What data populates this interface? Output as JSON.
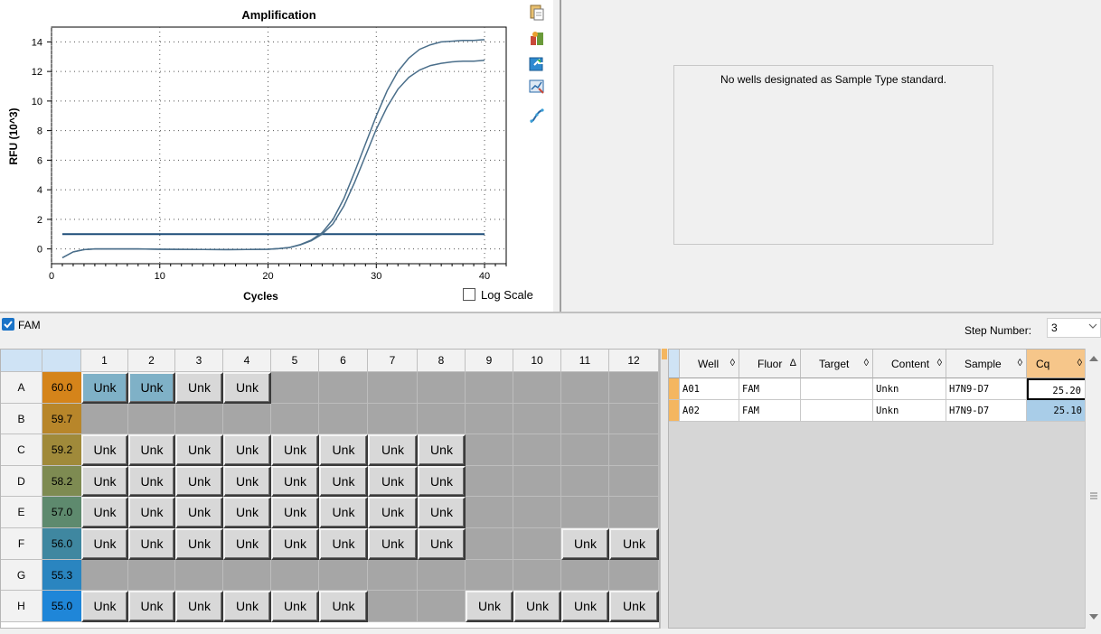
{
  "chart_data": {
    "type": "line",
    "title": "Amplification",
    "xlabel": "Cycles",
    "ylabel": "RFU (10^3)",
    "xlim": [
      0,
      42
    ],
    "ylim": [
      -1,
      15
    ],
    "xticks": [
      0,
      10,
      20,
      30,
      40
    ],
    "yticks": [
      0,
      2,
      4,
      6,
      8,
      10,
      12,
      14
    ],
    "grid": "dotted",
    "threshold": 1.0,
    "series": [
      {
        "well": "A01",
        "color": "#4a6e8a",
        "x": [
          1,
          2,
          3,
          4,
          6,
          8,
          10,
          12,
          14,
          16,
          18,
          20,
          21,
          22,
          23,
          24,
          25,
          26,
          27,
          28,
          29,
          30,
          31,
          32,
          33,
          34,
          35,
          36,
          37,
          38,
          39,
          40
        ],
        "y": [
          -0.6,
          -0.2,
          -0.05,
          0,
          0,
          0,
          -0.02,
          -0.03,
          -0.04,
          -0.05,
          -0.04,
          -0.02,
          0.02,
          0.1,
          0.3,
          0.6,
          1.1,
          2.0,
          3.4,
          5.2,
          7.1,
          9.0,
          10.7,
          12.0,
          12.9,
          13.5,
          13.8,
          14.0,
          14.05,
          14.1,
          14.1,
          14.15
        ]
      },
      {
        "well": "A02",
        "color": "#4a6e8a",
        "x": [
          1,
          2,
          3,
          4,
          6,
          8,
          10,
          12,
          14,
          16,
          18,
          20,
          21,
          22,
          23,
          24,
          25,
          26,
          27,
          28,
          29,
          30,
          31,
          32,
          33,
          34,
          35,
          36,
          37,
          38,
          39,
          40
        ],
        "y": [
          -0.6,
          -0.2,
          -0.05,
          0,
          0,
          0,
          -0.02,
          -0.03,
          -0.04,
          -0.05,
          -0.04,
          -0.02,
          0.02,
          0.1,
          0.28,
          0.55,
          1.0,
          1.7,
          2.9,
          4.5,
          6.3,
          8.1,
          9.6,
          10.8,
          11.6,
          12.1,
          12.4,
          12.55,
          12.65,
          12.7,
          12.7,
          12.75
        ]
      }
    ]
  },
  "chart": {
    "log_scale_label": "Log Scale"
  },
  "tool_icons": [
    "copy-icon",
    "report-icon",
    "export-icon",
    "chart-settings-icon",
    "curve-icon"
  ],
  "standard_curve": {
    "message": "No wells designated as Sample Type standard."
  },
  "fluor": {
    "label": "FAM",
    "checked": true
  },
  "step": {
    "label": "Step Number:",
    "value": "3"
  },
  "plate": {
    "columns": [
      "1",
      "2",
      "3",
      "4",
      "5",
      "6",
      "7",
      "8",
      "9",
      "10",
      "11",
      "12"
    ],
    "rows": [
      {
        "label": "A",
        "temp": "60.0",
        "temp_color": "#d5841a",
        "wells": [
          "Unk*",
          "Unk*",
          "Unk",
          "Unk",
          "",
          "",
          "",
          "",
          "",
          "",
          "",
          ""
        ]
      },
      {
        "label": "B",
        "temp": "59.7",
        "temp_color": "#b8862a",
        "wells": [
          "",
          "",
          "",
          "",
          "",
          "",
          "",
          "",
          "",
          "",
          "",
          ""
        ]
      },
      {
        "label": "C",
        "temp": "59.2",
        "temp_color": "#a08a3a",
        "wells": [
          "Unk",
          "Unk",
          "Unk",
          "Unk",
          "Unk",
          "Unk",
          "Unk",
          "Unk",
          "",
          "",
          "",
          ""
        ]
      },
      {
        "label": "D",
        "temp": "58.2",
        "temp_color": "#7e8b52",
        "wells": [
          "Unk",
          "Unk",
          "Unk",
          "Unk",
          "Unk",
          "Unk",
          "Unk",
          "Unk",
          "",
          "",
          "",
          ""
        ]
      },
      {
        "label": "E",
        "temp": "57.0",
        "temp_color": "#5e8a6e",
        "wells": [
          "Unk",
          "Unk",
          "Unk",
          "Unk",
          "Unk",
          "Unk",
          "Unk",
          "Unk",
          "",
          "",
          "",
          ""
        ]
      },
      {
        "label": "F",
        "temp": "56.0",
        "temp_color": "#3f87a0",
        "wells": [
          "Unk",
          "Unk",
          "Unk",
          "Unk",
          "Unk",
          "Unk",
          "Unk",
          "Unk",
          "",
          "",
          "Unk",
          "Unk"
        ]
      },
      {
        "label": "G",
        "temp": "55.3",
        "temp_color": "#2a85c0",
        "wells": [
          "",
          "",
          "",
          "",
          "",
          "",
          "",
          "",
          "",
          "",
          "",
          ""
        ]
      },
      {
        "label": "H",
        "temp": "55.0",
        "temp_color": "#1f86d8",
        "wells": [
          "Unk",
          "Unk",
          "Unk",
          "Unk",
          "Unk",
          "Unk",
          "",
          "",
          "Unk",
          "Unk",
          "Unk",
          "Unk"
        ]
      }
    ]
  },
  "results": {
    "columns": [
      {
        "label": "Well",
        "sort": "◊"
      },
      {
        "label": "Fluor",
        "sort": "Δ"
      },
      {
        "label": "Target",
        "sort": "◊"
      },
      {
        "label": "Content",
        "sort": "◊"
      },
      {
        "label": "Sample",
        "sort": "◊"
      },
      {
        "label": "Cq",
        "sort": "◊"
      }
    ],
    "rows": [
      {
        "well": "A01",
        "fluor": "FAM",
        "target": "",
        "content": "Unkn",
        "sample": "H7N9-D7",
        "cq": "25.20"
      },
      {
        "well": "A02",
        "fluor": "FAM",
        "target": "",
        "content": "Unkn",
        "sample": "H7N9-D7",
        "cq": "25.10"
      }
    ]
  },
  "colors": {
    "threshold": "#1f4e79",
    "curve": "#4a6e8a",
    "selected_well": "#7fb1c7",
    "cq_header": "#f6c68a",
    "cq_selected": "#a9cde8"
  }
}
